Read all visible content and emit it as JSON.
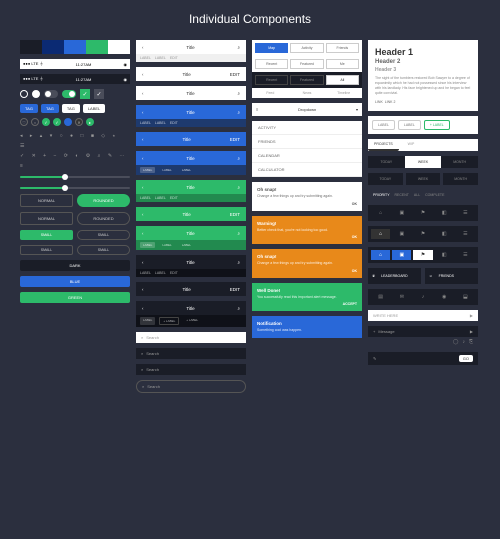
{
  "page_title": "Individual Components",
  "palette": [
    "#1a1d27",
    "#0b2a73",
    "#2968d8",
    "#2dba6a",
    "#ffffff"
  ],
  "status": {
    "carrier": "●●● LTE ⏚",
    "time": "11:27AM",
    "right": "◉"
  },
  "tag": "TAG",
  "label": "LABEL",
  "btn": {
    "normal": "NORMAL",
    "rounded": "ROUNDED",
    "small": "SMALL",
    "dark": "DARK",
    "blue": "BLUE",
    "green": "GREEN"
  },
  "title_text": "Title",
  "edit": "EDIT",
  "search": "Search",
  "tabs": {
    "map": "Map",
    "activity": "Activity",
    "friends": "Friends",
    "recent": "Recent",
    "featured": "Featured",
    "me": "Me",
    "all": "All",
    "feed": "Feed",
    "news": "News",
    "timeline": "Timeline"
  },
  "dropdown": "Dropdown",
  "menu": {
    "activity": "ACTIVITY",
    "friends": "FRIENDS",
    "calendar": "CALENDAR",
    "calculator": "CALCULATOR"
  },
  "alerts": {
    "snap_t": "Oh snap!",
    "snap_b": "Change a few things up and try submitting again.",
    "ok": "OK",
    "warn_t": "Warning!",
    "warn_b": "Better check that, you're not looking too good.",
    "done_t": "Well Done!",
    "done_b": "You successfully read this important alert message.",
    "accept": "ACCEPT",
    "notif_t": "Notification",
    "notif_b": "Something cool was happen."
  },
  "card": {
    "h1": "Header 1",
    "h2": "Header 2",
    "h3": "Header 3",
    "body": "The sight of the tumblers restored Bob Sawyer to a degree of equanimity which he had not possessed since his interview with his landlady. His face brightened up and he began to feel quite convivial.",
    "link1": "LINK",
    "link2": "LINK 2"
  },
  "plus_label": "+ LABEL",
  "tabs2": {
    "projects": "PROJECTS",
    "wip": "WIP"
  },
  "time": {
    "today": "TODAY",
    "week": "WEEK",
    "month": "MONTH"
  },
  "micro": {
    "priority": "PRIORITY",
    "recent": "RECENT",
    "all": "ALL",
    "complete": "COMPLETE"
  },
  "lb": {
    "leaderboard": "LEADERBOARD",
    "friends": "FRIENDS"
  },
  "msg": {
    "write": "WRITE HERE",
    "message": "Message",
    "go": "GO"
  }
}
